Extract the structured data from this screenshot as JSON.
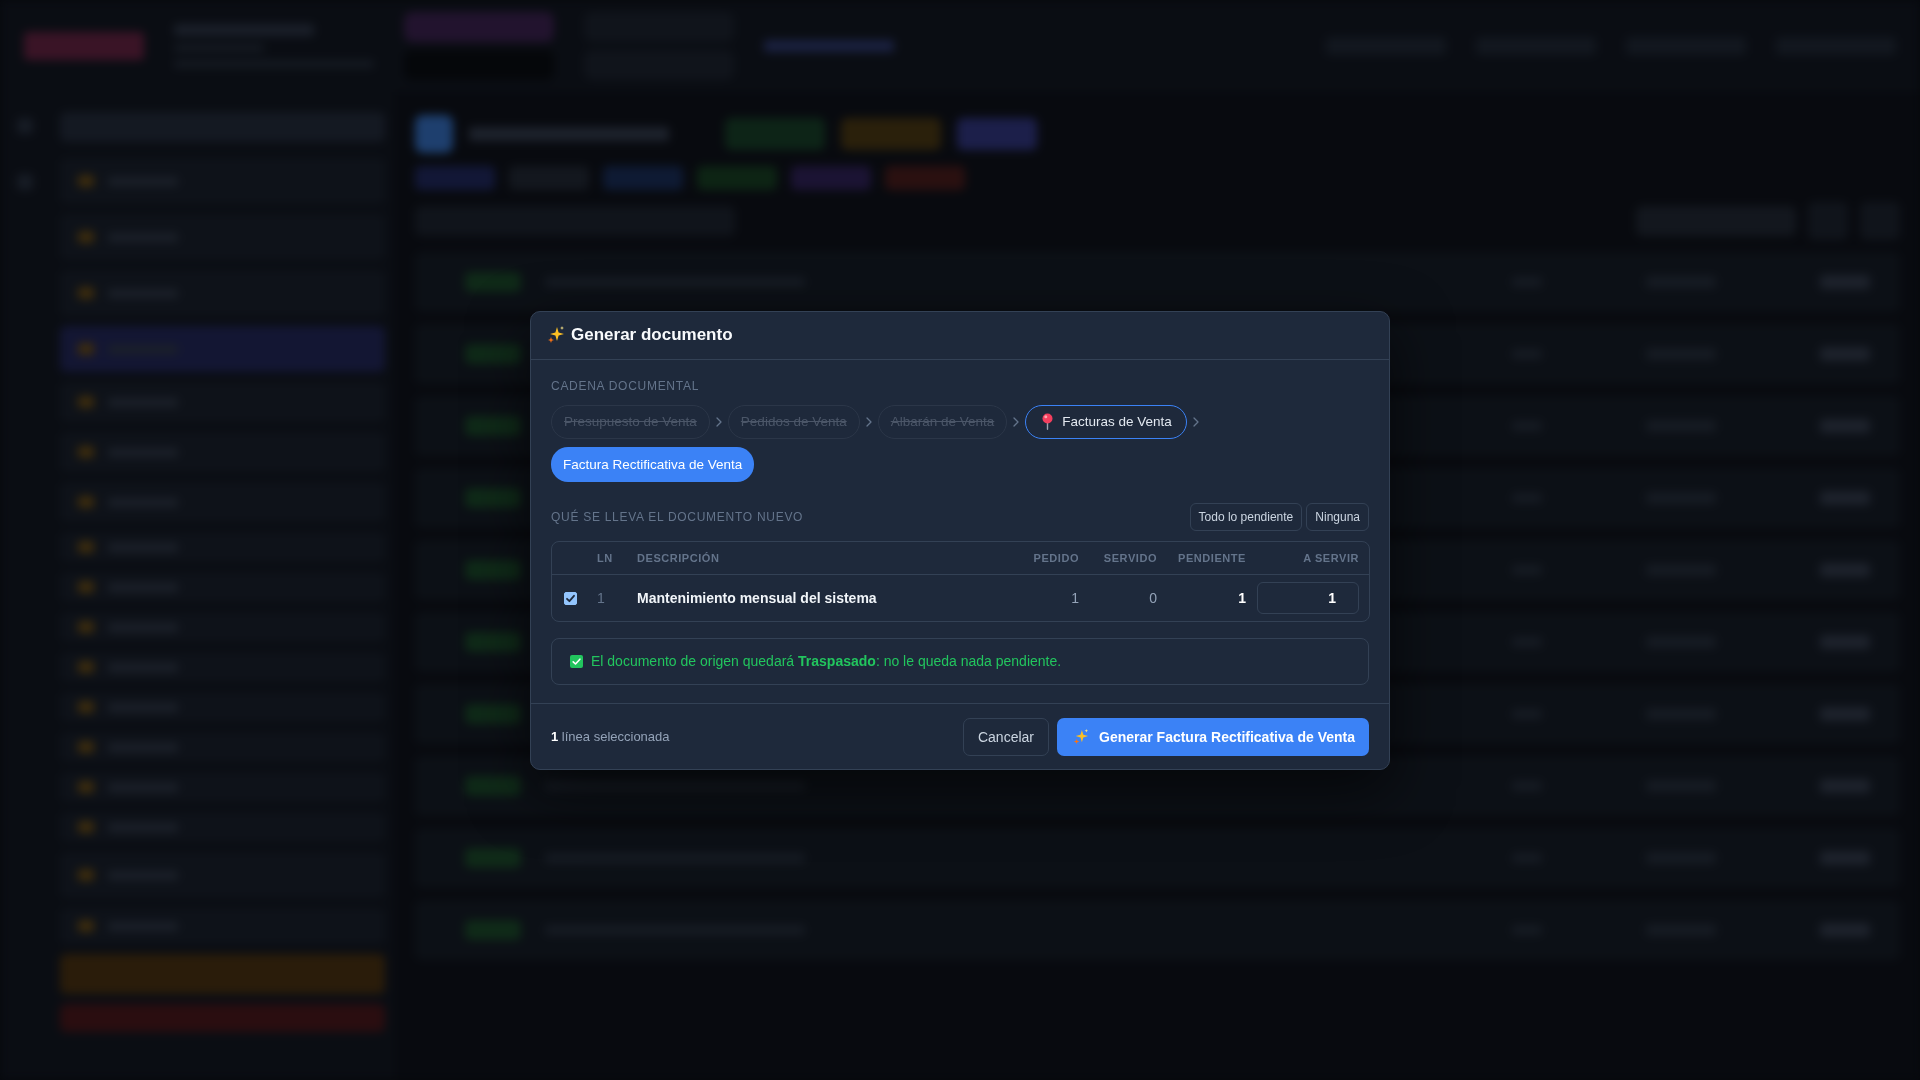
{
  "dialog": {
    "title": "Generar documento",
    "chain": {
      "label": "CADENA DOCUMENTAL",
      "steps": [
        {
          "label": "Presupuesto de Venta",
          "kind": "done"
        },
        {
          "label": "Pedidos de Venta",
          "kind": "done"
        },
        {
          "label": "Albarán de Venta",
          "kind": "done"
        },
        {
          "label": "Facturas de Venta",
          "kind": "current"
        },
        {
          "label": "Factura Rectificativa de Venta",
          "kind": "target"
        }
      ]
    },
    "lines": {
      "label": "QUÉ SE LLEVA EL DOCUMENTO NUEVO",
      "actions": [
        "Todo lo pendiente",
        "Ninguna"
      ],
      "columns": [
        "LN",
        "DESCRIPCIÓN",
        "PEDIDO",
        "SERVIDO",
        "PENDIENTE",
        "A SERVIR"
      ],
      "rows": [
        {
          "checked": true,
          "cells": [
            "1",
            "Mantenimiento mensual del sistema",
            "1",
            "0",
            "1"
          ],
          "quantity": "1"
        }
      ]
    },
    "notice": {
      "text": "El documento de origen quedará **Traspasado**: no le queda nada pendiente."
    },
    "footer": {
      "summary": "**1** línea seleccionada",
      "buttons": [
        {
          "label": "Cancelar",
          "kind": "secondary"
        },
        {
          "label": "Generar Factura Rectificativa de Venta",
          "kind": "primary"
        }
      ]
    }
  }
}
